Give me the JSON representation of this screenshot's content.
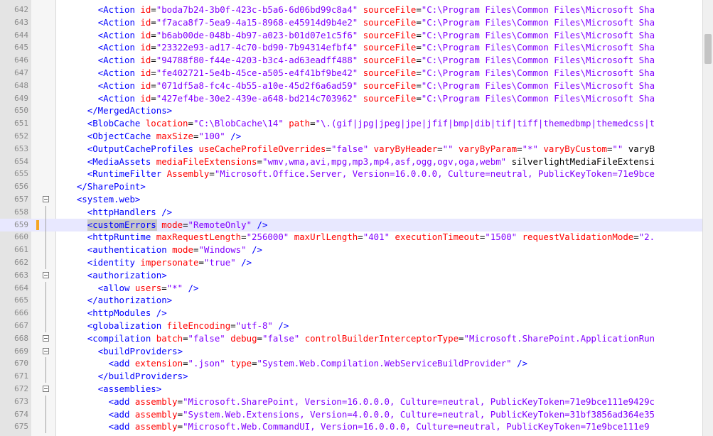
{
  "colors": {
    "tag": "#0000ff",
    "attribute": "#ff0000",
    "string": "#8000ff",
    "text": "#000000",
    "line_number": "#8a8a8a",
    "current_line_bg": "#e8e8ff",
    "bookmark_marker": "#f5a623"
  },
  "icons": {
    "fold_box": "fold-minus-box-icon"
  },
  "editor": {
    "lines": [
      {
        "n": "642",
        "text": "        <Action id=\"boda7b24-3b0f-423c-b5a6-6d06bd99c8a4\" sourceFile=\"C:\\Program Files\\Common Files\\Microsoft Sha"
      },
      {
        "n": "643",
        "text": "        <Action id=\"f7aca8f7-5ea9-4a15-8968-e45914d9b4e2\" sourceFile=\"C:\\Program Files\\Common Files\\Microsoft Sha"
      },
      {
        "n": "644",
        "text": "        <Action id=\"b6ab00de-048b-4b97-a023-b01d07e1c5f6\" sourceFile=\"C:\\Program Files\\Common Files\\Microsoft Sha"
      },
      {
        "n": "645",
        "text": "        <Action id=\"23322e93-ad17-4c70-bd90-7b94314efbf4\" sourceFile=\"C:\\Program Files\\Common Files\\Microsoft Sha"
      },
      {
        "n": "646",
        "text": "        <Action id=\"94788f80-f44e-4203-b3c4-ad63eadff488\" sourceFile=\"C:\\Program Files\\Common Files\\Microsoft Sha"
      },
      {
        "n": "647",
        "text": "        <Action id=\"fe402721-5e4b-45ce-a505-e4f41bf9be42\" sourceFile=\"C:\\Program Files\\Common Files\\Microsoft Sha"
      },
      {
        "n": "648",
        "text": "        <Action id=\"071df5a8-fc4c-4b55-a10e-45d2f6a6ad59\" sourceFile=\"C:\\Program Files\\Common Files\\Microsoft Sha"
      },
      {
        "n": "649",
        "text": "        <Action id=\"427ef4be-30e2-439e-a648-bd214c703962\" sourceFile=\"C:\\Program Files\\Common Files\\Microsoft Sha"
      },
      {
        "n": "650",
        "text": "      </MergedActions>"
      },
      {
        "n": "651",
        "text": "      <BlobCache location=\"C:\\BlobCache\\14\" path=\"\\.(gif|jpg|jpeg|jpe|jfif|bmp|dib|tif|tiff|themedbmp|themedcss|t"
      },
      {
        "n": "652",
        "text": "      <ObjectCache maxSize=\"100\" />"
      },
      {
        "n": "653",
        "text": "      <OutputCacheProfiles useCacheProfileOverrides=\"false\" varyByHeader=\"\" varyByParam=\"*\" varyByCustom=\"\" varyB"
      },
      {
        "n": "654",
        "text": "      <MediaAssets mediaFileExtensions=\"wmv,wma,avi,mpg,mp3,mp4,asf,ogg,ogv,oga,webm\" silverlightMediaFileExtensi"
      },
      {
        "n": "655",
        "text": "      <RuntimeFilter Assembly=\"Microsoft.Office.Server, Version=16.0.0.0, Culture=neutral, PublicKeyToken=71e9bce"
      },
      {
        "n": "656",
        "text": "    </SharePoint>"
      },
      {
        "n": "657",
        "text": "    <system.web>"
      },
      {
        "n": "658",
        "text": "      <httpHandlers />"
      },
      {
        "n": "659",
        "text": "      <customErrors mode=\"RemoteOnly\" />"
      },
      {
        "n": "660",
        "text": "      <httpRuntime maxRequestLength=\"256000\" maxUrlLength=\"401\" executionTimeout=\"1500\" requestValidationMode=\"2."
      },
      {
        "n": "661",
        "text": "      <authentication mode=\"Windows\" />"
      },
      {
        "n": "662",
        "text": "      <identity impersonate=\"true\" />"
      },
      {
        "n": "663",
        "text": "      <authorization>"
      },
      {
        "n": "664",
        "text": "        <allow users=\"*\" />"
      },
      {
        "n": "665",
        "text": "      </authorization>"
      },
      {
        "n": "666",
        "text": "      <httpModules />"
      },
      {
        "n": "667",
        "text": "      <globalization fileEncoding=\"utf-8\" />"
      },
      {
        "n": "668",
        "text": "      <compilation batch=\"false\" debug=\"false\" controlBuilderInterceptorType=\"Microsoft.SharePoint.ApplicationRun"
      },
      {
        "n": "669",
        "text": "        <buildProviders>"
      },
      {
        "n": "670",
        "text": "          <add extension=\".json\" type=\"System.Web.Compilation.WebServiceBuildProvider\" />"
      },
      {
        "n": "671",
        "text": "        </buildProviders>"
      },
      {
        "n": "672",
        "text": "        <assemblies>"
      },
      {
        "n": "673",
        "text": "          <add assembly=\"Microsoft.SharePoint, Version=16.0.0.0, Culture=neutral, PublicKeyToken=71e9bce111e9429c"
      },
      {
        "n": "674",
        "text": "          <add assembly=\"System.Web.Extensions, Version=4.0.0.0, Culture=neutral, PublicKeyToken=31bf3856ad364e35"
      },
      {
        "n": "675",
        "text": "          <add assembly=\"Microsoft.Web.CommandUI, Version=16.0.0.0, Culture=neutral, PublicKeyToken=71e9bce111e9"
      }
    ],
    "current_line": "659",
    "fold_lines": [
      "657",
      "663",
      "668",
      "669",
      "672"
    ],
    "selection": {
      "line": "659",
      "text": "<customErrors",
      "match": "\"RemoteOnly\""
    }
  }
}
